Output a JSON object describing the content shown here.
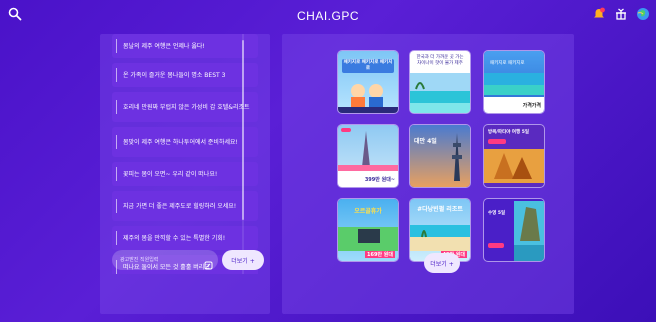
{
  "header": {
    "brand": "CHAI.GPC",
    "icons": [
      "search-icon",
      "notification-icon",
      "gift-icon",
      "globe-icon"
    ]
  },
  "left_panel": {
    "items": [
      {
        "label": "봄날의 제주 여행은 언제나 옳다!"
      },
      {
        "label": "온 가족이 즐거운 봄나들이 명소 BEST 3"
      },
      {
        "label": "호리네 만원짜 부럽지 않은 가성비 갑 호텔&리조트"
      },
      {
        "label": "봄맞이 제주 여행은 하나투어에서 준비하세요!"
      },
      {
        "label": "꽃피는 봄이 오면~ 우리 같이 떠나요!"
      },
      {
        "label": "지금 가면 더 좋은 제주도로 힐링하러 오세요!"
      },
      {
        "label": "제주의 봄을 만끽할 수 있는 특별한 기회!"
      },
      {
        "label": "떠나요 둘이서 모든 것 훌훌 버리고"
      }
    ],
    "input_placeholder": "광고받진 직원입력",
    "more_label": "더보기 +"
  },
  "right_panel": {
    "more_label": "더보기 +",
    "cards": [
      {
        "caption": "패키지로 패키지로 패키지로",
        "footer": "",
        "price": ""
      },
      {
        "caption": "한국과 더 가까운 곳 가는 차이나이 핫이 불가 제주",
        "footer": "",
        "price": ""
      },
      {
        "caption": "패키지로 패키지로",
        "footer": "",
        "price": "가격가격"
      },
      {
        "caption": "",
        "footer": "",
        "price": "399만 원대~"
      },
      {
        "caption": "대만 4일",
        "footer": "",
        "price": ""
      },
      {
        "caption": "방콕/파타야 여행 5일",
        "footer": "",
        "price": ""
      },
      {
        "caption": "오르골휴가",
        "footer": "",
        "price": "169만 원대"
      },
      {
        "caption": "#다낭빈펄 리조트",
        "footer": "",
        "price": "49만 원대"
      },
      {
        "caption": "수영 5일",
        "footer": "",
        "price": ""
      }
    ]
  },
  "colors": {
    "bg": "#4a12c9",
    "panel": "#7846e6",
    "accent_pink": "#ff3a82",
    "button_bg": "#efe7ff",
    "button_text": "#4a1fc8"
  }
}
